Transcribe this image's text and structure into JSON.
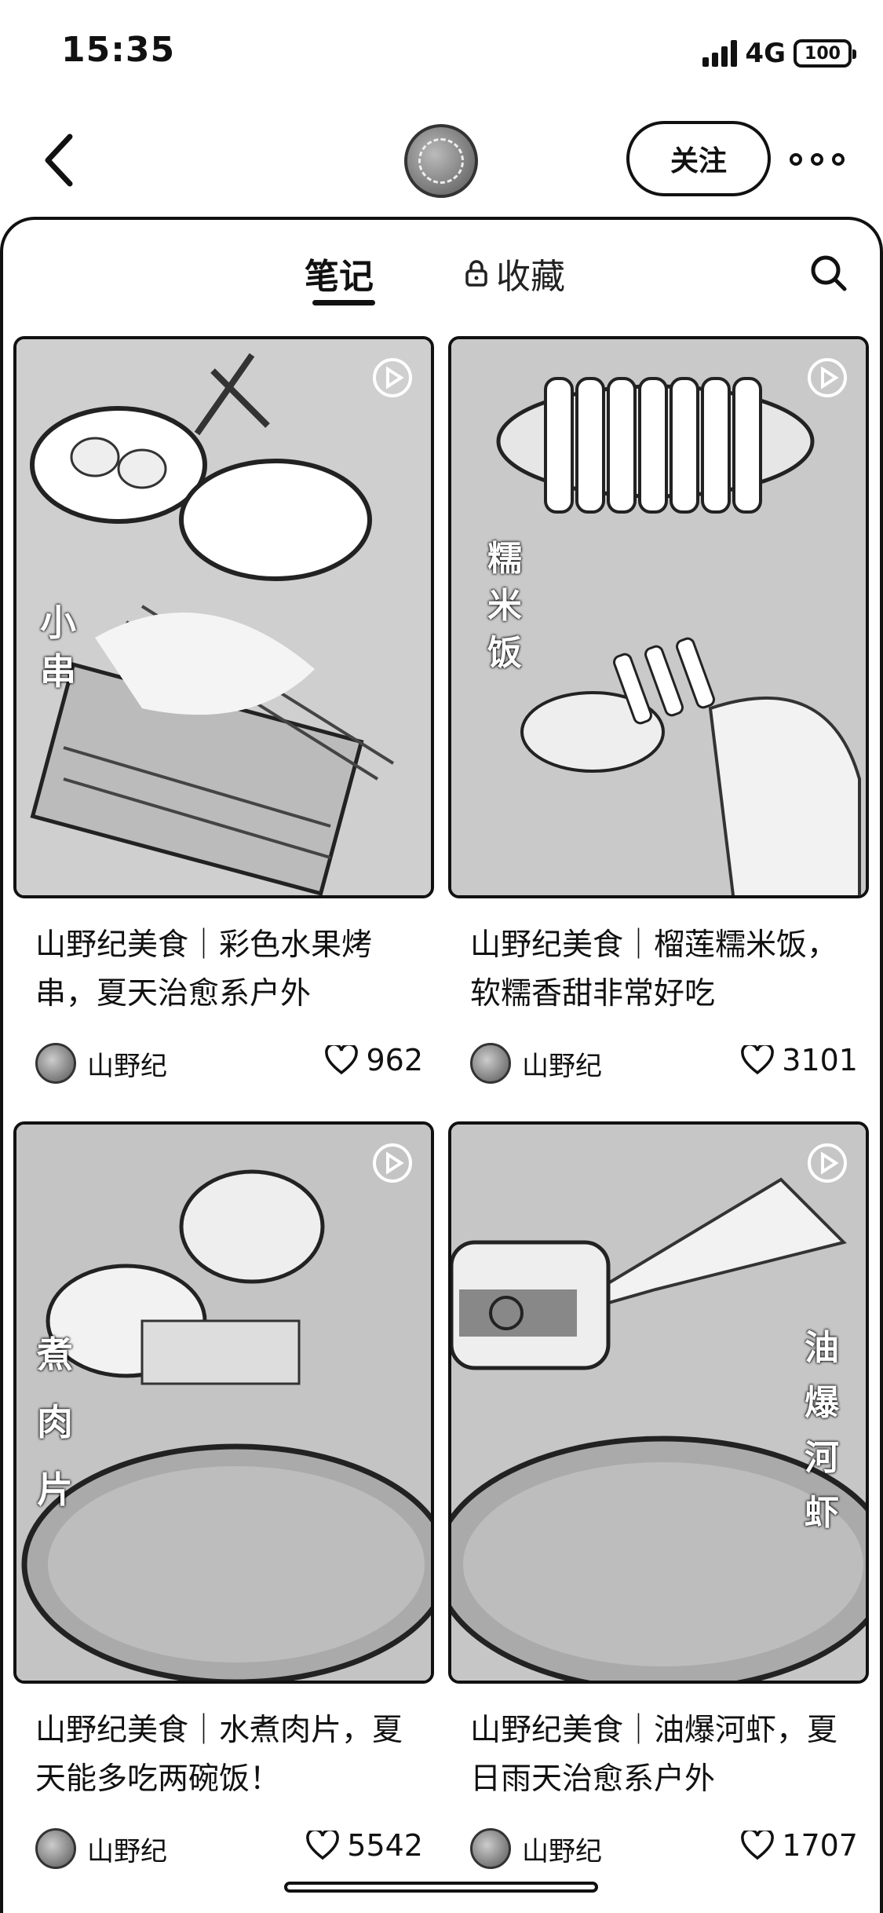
{
  "status_bar": {
    "time": "15:35",
    "network": "4G",
    "battery": "100"
  },
  "header": {
    "follow_label": "关注"
  },
  "tabs": {
    "notes": "笔记",
    "collections": "收藏"
  },
  "notes": [
    {
      "title": "山野纪美食｜彩色水果烤串，夏天治愈系户外",
      "author": "山野纪",
      "likes": "962",
      "overlay_text": "小串"
    },
    {
      "title": "山野纪美食｜榴莲糯米饭，软糯香甜非常好吃",
      "author": "山野纪",
      "likes": "3101",
      "overlay_text": "糯米饭"
    },
    {
      "title": "山野纪美食｜水煮肉片，夏天能多吃两碗饭！",
      "author": "山野纪",
      "likes": "5542",
      "overlay_text": "煮肉片"
    },
    {
      "title": "山野纪美食｜油爆河虾，夏日雨天治愈系户外",
      "author": "山野纪",
      "likes": "1707",
      "overlay_text": "油爆河虾"
    }
  ],
  "icons": {
    "back": "chevron-left-icon",
    "more": "more-dots-icon",
    "lock": "lock-icon",
    "search": "search-icon",
    "video": "play-icon",
    "like": "heart-icon"
  }
}
